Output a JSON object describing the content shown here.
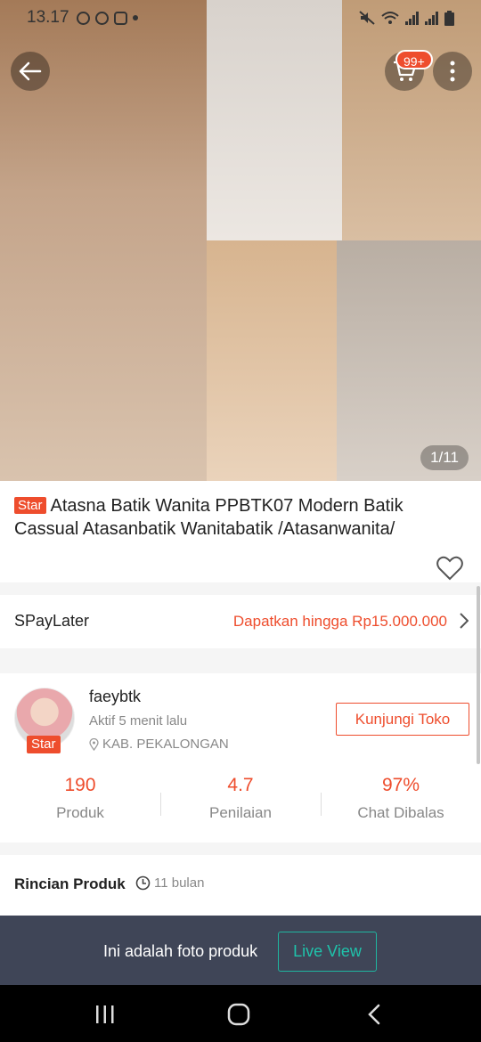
{
  "status_bar": {
    "time": "13.17"
  },
  "header": {
    "cart_badge": "99+",
    "image_index": "1/11"
  },
  "product": {
    "badge": "Star",
    "title": "Atasna Batik Wanita PPBTK07 Modern Batik Cassual Atasanbatik Wanitabatik /Atasanwanita/"
  },
  "spaylater": {
    "label": "SPayLater",
    "promo": "Dapatkan hingga Rp15.000.000"
  },
  "shop": {
    "name": "faeybtk",
    "active": "Aktif 5 menit lalu",
    "location": "KAB. PEKALONGAN",
    "badge": "Star",
    "visit_label": "Kunjungi Toko",
    "stats": [
      {
        "value": "190",
        "label": "Produk"
      },
      {
        "value": "4.7",
        "label": "Penilaian"
      },
      {
        "value": "97%",
        "label": "Chat Dibalas"
      }
    ]
  },
  "details": {
    "title": "Rincian Produk",
    "time": "11 bulan"
  },
  "banner": {
    "text": "Ini adalah foto produk",
    "button": "Live View"
  },
  "colors": {
    "accent": "#ee4d2d",
    "live": "#1fc3ab",
    "banner_bg": "#3f4557"
  },
  "icons": [
    "back-arrow-icon",
    "cart-icon",
    "more-vertical-icon",
    "heart-icon",
    "chevron-right-icon",
    "location-pin-icon",
    "clock-icon",
    "recents-icon",
    "home-icon",
    "back-icon"
  ]
}
